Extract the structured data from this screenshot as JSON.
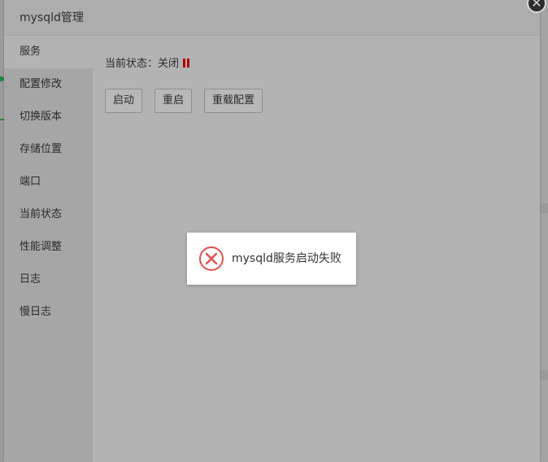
{
  "dialog": {
    "title": "mysqld管理",
    "close_symbol": "✕"
  },
  "sidebar": {
    "items": [
      {
        "label": "服务",
        "active": true
      },
      {
        "label": "配置修改"
      },
      {
        "label": "切换版本"
      },
      {
        "label": "存储位置"
      },
      {
        "label": "端口"
      },
      {
        "label": "当前状态"
      },
      {
        "label": "性能调整"
      },
      {
        "label": "日志"
      },
      {
        "label": "慢日志"
      }
    ]
  },
  "service": {
    "status_label": "当前状态：",
    "status_value": "关闭",
    "status_icon": "pause-icon",
    "status_color": "#b10000",
    "buttons": {
      "start": "启动",
      "restart": "重启",
      "reload": "重载配置"
    }
  },
  "toast": {
    "message": "mysqld服务启动失败",
    "icon": "error-circle-icon",
    "icon_color": "#e0514b"
  }
}
